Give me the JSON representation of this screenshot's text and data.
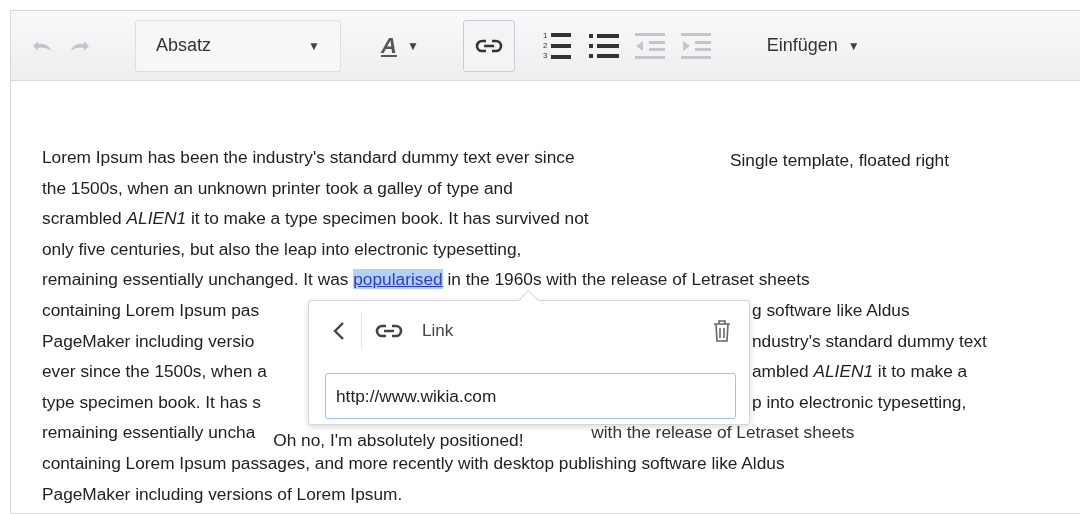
{
  "toolbar": [
    {
      "kind": "undo",
      "disabled": true
    },
    {
      "kind": "redo",
      "disabled": true
    },
    {
      "kind": "dropdown",
      "label": "Absatz",
      "caret": "▼"
    },
    {
      "kind": "text-color",
      "label": "A",
      "caret": "▼"
    },
    {
      "kind": "link",
      "active": true
    },
    {
      "kind": "numbered-list",
      "disabled": false,
      "digits": [
        "1",
        "2",
        "3"
      ]
    },
    {
      "kind": "bullet-list",
      "disabled": false
    },
    {
      "kind": "outdent",
      "disabled": true
    },
    {
      "kind": "indent",
      "disabled": true
    },
    {
      "kind": "menu",
      "label": "Einfügen",
      "caret": "▼"
    }
  ],
  "document": {
    "float_note": "Single template, floated right",
    "top_lines": [
      "Lorem Ipsum has been the industry's standard dummy text ever since",
      "the 1500s, when an unknown printer took a galley of type and",
      "scrambled *ALIEN1* it to make a type specimen book. It has survived not",
      "only five centuries, but also the leap into electronic typesetting,"
    ],
    "link_line": [
      {
        "kind": "text",
        "text": "remaining essentially unchanged. It was "
      },
      {
        "kind": "link",
        "text": "popularised",
        "selected": true
      },
      {
        "kind": "text",
        "text": " in the 1960s with the release of Letraset sheets"
      }
    ],
    "covered_lines": [
      {
        "left": "containing Lorem Ipsum pas",
        "right": "g software like Aldus"
      },
      {
        "left": "PageMaker including versio",
        "right": "ndustry's standard dummy text"
      },
      {
        "left": "ever since the 1500s, when a",
        "right": "ambled *ALIEN1* it to make a"
      },
      {
        "left": "type specimen book. It has s",
        "right": "p into electronic typesetting,"
      }
    ],
    "overlay_line": {
      "left": "remaining essentially uncha",
      "overlay": "Oh no, I'm absolutely positioned!",
      "right": "with the release of Letraset sheets"
    },
    "bottom_lines": [
      "containing Lorem Ipsum passages, and more recently with desktop publishing software like Aldus",
      "PageMaker including versions of Lorem Ipsum."
    ]
  },
  "link_popup": {
    "title": "Link",
    "url": "http://www.wikia.com"
  }
}
